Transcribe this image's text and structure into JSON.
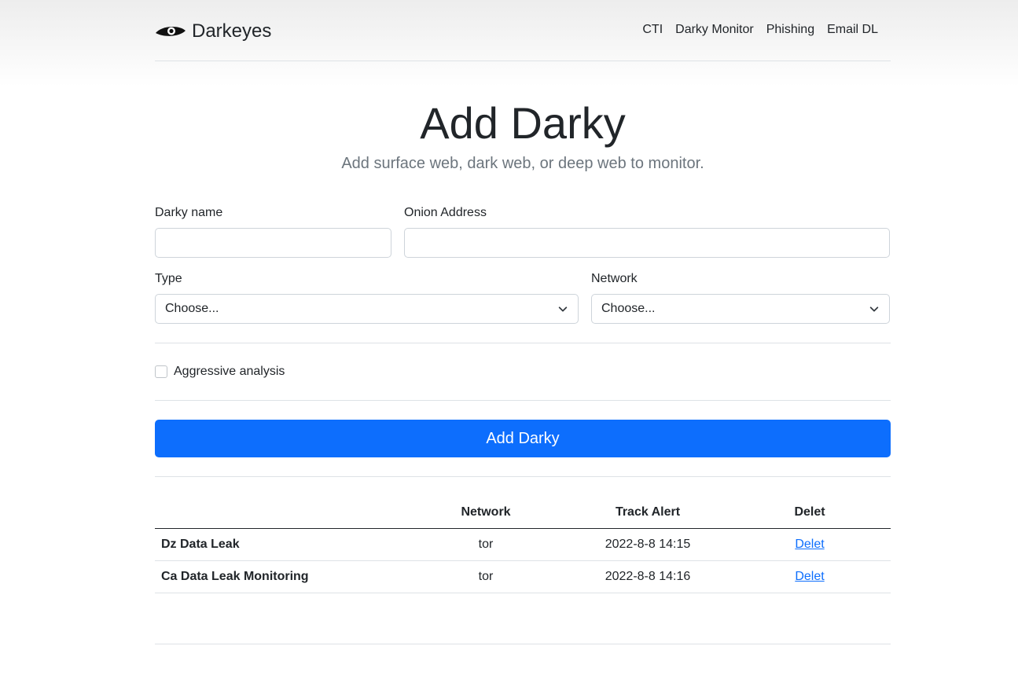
{
  "brand": {
    "name": "Darkeyes"
  },
  "nav": {
    "items": [
      "CTI",
      "Darky Monitor",
      "Phishing",
      "Email DL"
    ]
  },
  "hero": {
    "title": "Add Darky",
    "subtitle": "Add surface web, dark web, or deep web to monitor."
  },
  "form": {
    "name_label": "Darky name",
    "name_value": "",
    "onion_label": "Onion Address",
    "onion_value": "",
    "type_label": "Type",
    "type_selected": "Choose...",
    "network_label": "Network",
    "network_selected": "Choose...",
    "aggressive_label": "Aggressive analysis",
    "aggressive_checked": false,
    "submit_label": "Add Darky"
  },
  "table": {
    "headers": [
      "",
      "Network",
      "Track Alert",
      "Delet"
    ],
    "rows": [
      {
        "name": "Dz Data Leak",
        "network": "tor",
        "track_alert": "2022-8-8 14:15",
        "action": "Delet"
      },
      {
        "name": "Ca Data Leak Monitoring",
        "network": "tor",
        "track_alert": "2022-8-8 14:16",
        "action": "Delet"
      }
    ]
  },
  "colors": {
    "primary": "#0d6efd",
    "muted": "#6c757d",
    "border": "#dee2e6"
  }
}
